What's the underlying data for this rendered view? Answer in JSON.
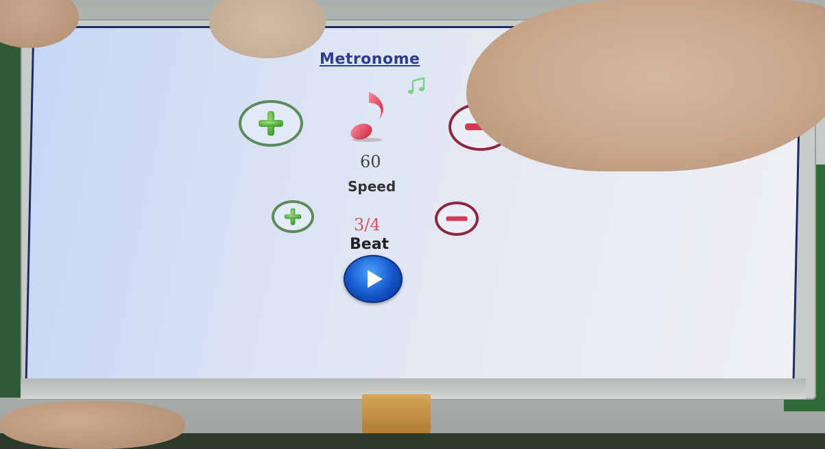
{
  "app": {
    "title": "Metronome"
  },
  "speed": {
    "value": "60",
    "label": "Speed"
  },
  "beat": {
    "value": "3/4",
    "label": "Beat"
  },
  "icons": {
    "speed_increase": "plus-icon",
    "speed_decrease": "minus-icon",
    "beat_increase": "plus-icon",
    "beat_decrease": "minus-icon",
    "note": "music-note-icon",
    "small_note": "double-music-note-icon",
    "play": "play-icon"
  },
  "colors": {
    "title": "#2d3e8f",
    "plus": "#5b8b5a",
    "minus": "#8f2640",
    "note": "#e2405a",
    "beat_value": "#d25466",
    "play": "#1354c8",
    "screen_border": "#1f2a66"
  }
}
